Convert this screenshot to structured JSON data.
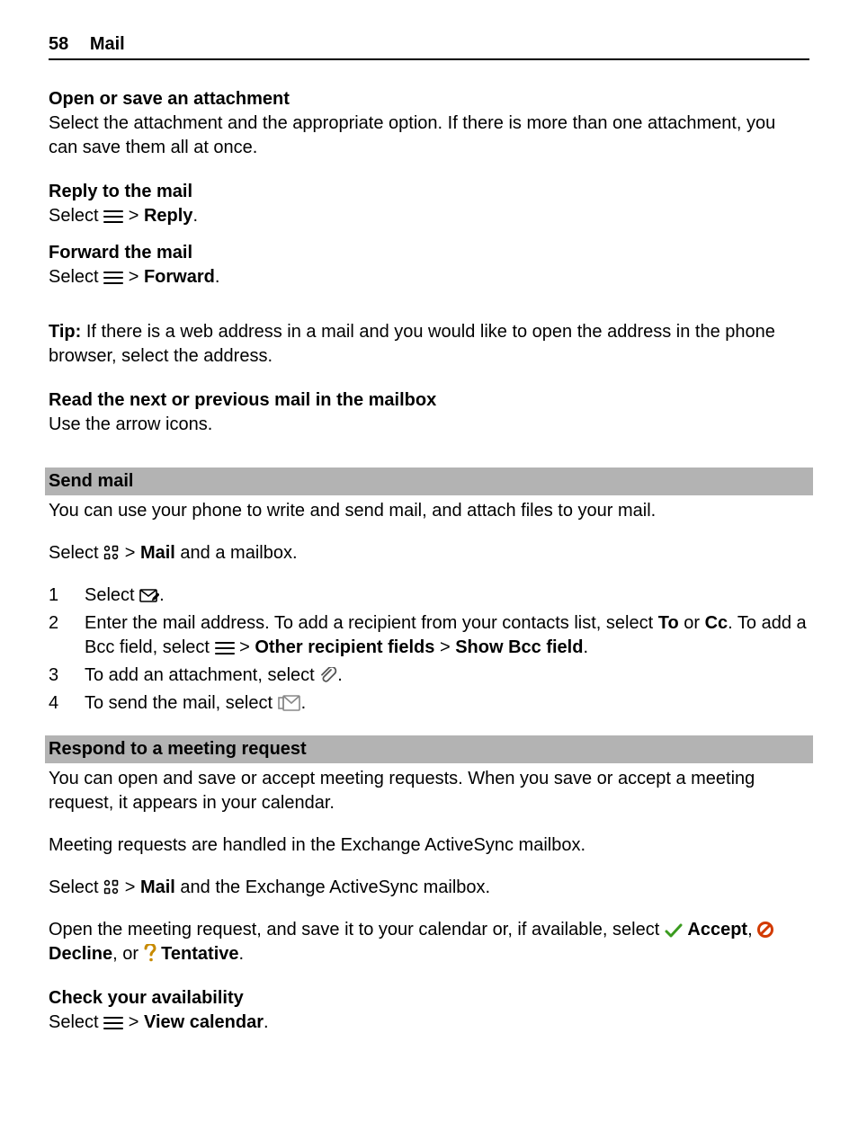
{
  "header": {
    "page_number": "58",
    "chapter": "Mail"
  },
  "open_attachment": {
    "title": "Open or save an attachment",
    "body": "Select the attachment and the appropriate option. If there is more than one attachment, you can save them all at once."
  },
  "reply": {
    "title": "Reply to the mail",
    "select": "Select ",
    "gt": " > ",
    "action": "Reply",
    "period": "."
  },
  "forward": {
    "title": "Forward the mail",
    "select": "Select ",
    "gt": " > ",
    "action": "Forward",
    "period": "."
  },
  "tip": {
    "label": "Tip:",
    "body": " If there is a web address in a mail and you would like to open the address in the phone browser, select the address."
  },
  "read_next": {
    "title": "Read the next or previous mail in the mailbox",
    "body": "Use the arrow icons."
  },
  "send_mail": {
    "title": "Send mail",
    "intro": "You can use your phone to write and send mail, and attach files to your mail.",
    "select": "Select ",
    "gt": " > ",
    "mail_word": "Mail",
    "after_mail": " and a mailbox.",
    "steps": {
      "n1": "1",
      "n2": "2",
      "n3": "3",
      "n4": "4",
      "s1_select": "Select ",
      "s1_period": ".",
      "s2_a": "Enter the mail address. To add a recipient from your contacts list, select ",
      "s2_to": "To",
      "s2_or": " or ",
      "s2_cc": "Cc",
      "s2_b": ". To add a Bcc field, select ",
      "s2_gt1": " > ",
      "s2_other": "Other recipient fields",
      "s2_gt2": "  > ",
      "s2_showbcc": "Show Bcc field",
      "s2_period": ".",
      "s3_a": "To add an attachment, select ",
      "s3_period": ".",
      "s4_a": "To send the mail, select ",
      "s4_period": "."
    }
  },
  "meeting": {
    "title": "Respond to a meeting request",
    "p1": "You can open and save or accept meeting requests. When you save or accept a meeting request, it appears in your calendar.",
    "p2": "Meeting requests are handled in the Exchange ActiveSync mailbox.",
    "select": "Select ",
    "gt": " > ",
    "mail_word": "Mail",
    "after_mail": " and the Exchange ActiveSync mailbox.",
    "p4_a": "Open the meeting request, and save it to your calendar or, if available, select ",
    "accept": "Accept",
    "comma": ", ",
    "decline": "Decline",
    "or": ", or ",
    "tentative": "Tentative",
    "period": "."
  },
  "check_avail": {
    "title": "Check your availability",
    "select": "Select ",
    "gt": " > ",
    "action": "View calendar",
    "period": "."
  }
}
